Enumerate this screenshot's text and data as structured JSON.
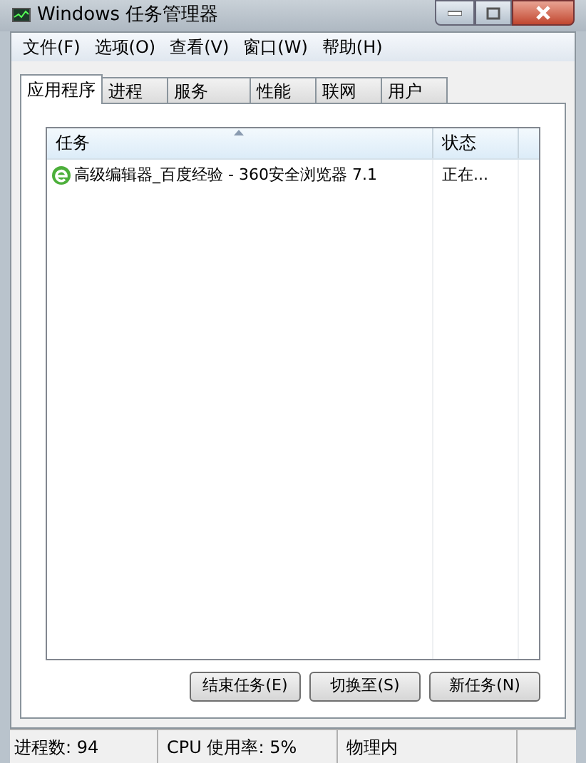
{
  "window": {
    "title": "Windows 任务管理器"
  },
  "menu": [
    "文件(F)",
    "选项(O)",
    "查看(V)",
    "窗口(W)",
    "帮助(H)"
  ],
  "tabs": [
    {
      "label": "应用程序",
      "selected": true
    },
    {
      "label": "进程",
      "selected": false
    },
    {
      "label": "服务",
      "selected": false
    },
    {
      "label": "性能",
      "selected": false
    },
    {
      "label": "联网",
      "selected": false
    },
    {
      "label": "用户",
      "selected": false
    }
  ],
  "table": {
    "columns": [
      "任务",
      "状态"
    ],
    "rows": [
      {
        "task": "高级编辑器_百度经验 - 360安全浏览器 7.1",
        "status": "正在..."
      }
    ]
  },
  "buttons": [
    "结束任务(E)",
    "切换至(S)",
    "新任务(N)"
  ],
  "status_bar": [
    "进程数: 94",
    "CPU 使用率: 5%",
    "物理内"
  ]
}
